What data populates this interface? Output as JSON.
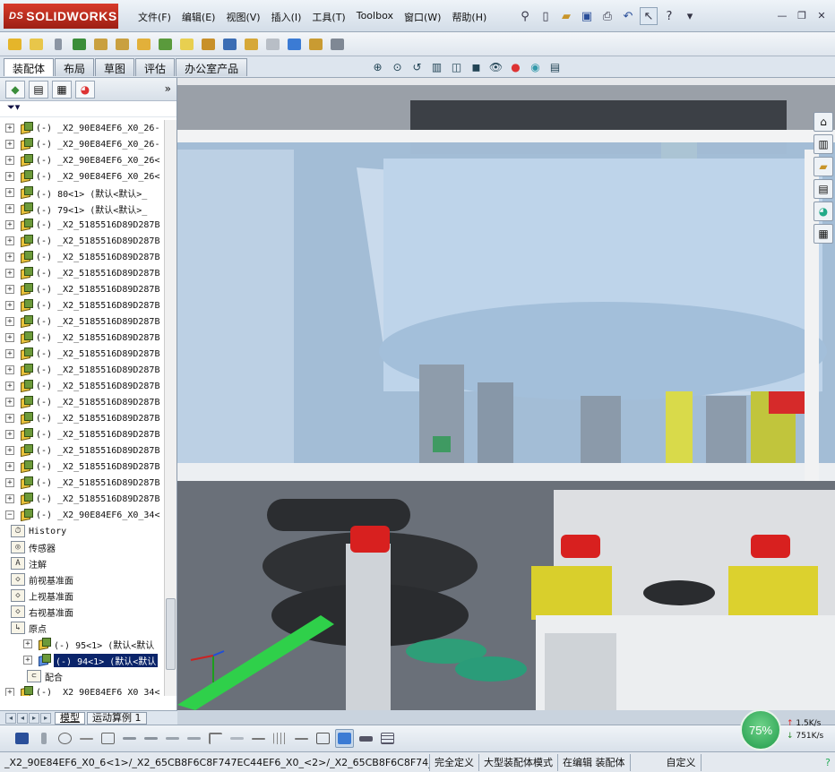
{
  "app": {
    "brand_prefix": "DS",
    "brand": "SOLIDWORKS"
  },
  "menus": [
    "文件(F)",
    "编辑(E)",
    "视图(V)",
    "插入(I)",
    "工具(T)",
    "Toolbox",
    "窗口(W)",
    "帮助(H)"
  ],
  "tabs": [
    "装配体",
    "布局",
    "草图",
    "评估",
    "办公室产品"
  ],
  "active_tab": 0,
  "panel": {
    "filter_icon": "funnel-icon",
    "more": "»"
  },
  "tree": [
    {
      "label": "(-) _X2_90E84EF6_X0_26-",
      "type": "part"
    },
    {
      "label": "(-) _X2_90E84EF6_X0_26-",
      "type": "part"
    },
    {
      "label": "(-) _X2_90E84EF6_X0_26<",
      "type": "part"
    },
    {
      "label": "(-) _X2_90E84EF6_X0_26<",
      "type": "part"
    },
    {
      "label": "(-) 80<1> (默认<默认>_",
      "type": "part"
    },
    {
      "label": "(-) 79<1> (默认<默认>_",
      "type": "part"
    },
    {
      "label": "(-) _X2_5185516D89D287B",
      "type": "part"
    },
    {
      "label": "(-) _X2_5185516D89D287B",
      "type": "part"
    },
    {
      "label": "(-) _X2_5185516D89D287B",
      "type": "part"
    },
    {
      "label": "(-) _X2_5185516D89D287B",
      "type": "part"
    },
    {
      "label": "(-) _X2_5185516D89D287B",
      "type": "part"
    },
    {
      "label": "(-) _X2_5185516D89D287B",
      "type": "part"
    },
    {
      "label": "(-) _X2_5185516D89D287B",
      "type": "part"
    },
    {
      "label": "(-) _X2_5185516D89D287B",
      "type": "part"
    },
    {
      "label": "(-) _X2_5185516D89D287B",
      "type": "part"
    },
    {
      "label": "(-) _X2_5185516D89D287B",
      "type": "part"
    },
    {
      "label": "(-) _X2_5185516D89D287B",
      "type": "part"
    },
    {
      "label": "(-) _X2_5185516D89D287B",
      "type": "part"
    },
    {
      "label": "(-) _X2_5185516D89D287B",
      "type": "part"
    },
    {
      "label": "(-) _X2_5185516D89D287B",
      "type": "part"
    },
    {
      "label": "(-) _X2_5185516D89D287B",
      "type": "part"
    },
    {
      "label": "(-) _X2_5185516D89D287B",
      "type": "part"
    },
    {
      "label": "(-) _X2_5185516D89D287B",
      "type": "part"
    },
    {
      "label": "(-) _X2_5185516D89D287B",
      "type": "part"
    },
    {
      "label": "(-) _X2_90E84EF6_X0_34<",
      "type": "part",
      "expanded": true
    },
    {
      "label": "History",
      "type": "sub",
      "icon": "history-icon"
    },
    {
      "label": "传感器",
      "type": "sub",
      "icon": "sensor-icon"
    },
    {
      "label": "注解",
      "type": "sub",
      "icon": "annotation-icon"
    },
    {
      "label": "前视基准面",
      "type": "sub",
      "icon": "plane-icon"
    },
    {
      "label": "上视基准面",
      "type": "sub",
      "icon": "plane-icon"
    },
    {
      "label": "右视基准面",
      "type": "sub",
      "icon": "plane-icon"
    },
    {
      "label": "原点",
      "type": "sub",
      "icon": "origin-icon"
    },
    {
      "label": "(-) 95<1> (默认<默认",
      "type": "part",
      "indent": true
    },
    {
      "label": "(-) 94<1> (默认<默认",
      "type": "part",
      "indent": true,
      "selected": true
    },
    {
      "label": "配合",
      "type": "sub",
      "icon": "mates-icon",
      "noexp": true
    },
    {
      "label": "(-) _X2_90E84EF6_X0_34<",
      "type": "part"
    }
  ],
  "bottom_tabs": [
    "模型",
    "运动算例 1"
  ],
  "active_bottom_tab": 0,
  "status": {
    "path": "_X2_90E84EF6_X0_6<1>/_X2_65CB8F6C8F747EC44EF6_X0_<2>/_X2_65CB8F6C8F74_X0_<1>",
    "fully_defined": "完全定义",
    "mode": "大型装配体模式",
    "editing": "在编辑 装配体",
    "units": "自定义",
    "help": "?"
  },
  "network": {
    "percent": "75%",
    "up": "1.5K/s",
    "down": "751K/s"
  },
  "colors": {
    "accent": "#d73a2a",
    "selection": "#0a246a"
  },
  "viewport": {
    "content": "3D model: rotary filling machine with transparent blue guard panel, red knobs, yellow guides, green rails"
  }
}
